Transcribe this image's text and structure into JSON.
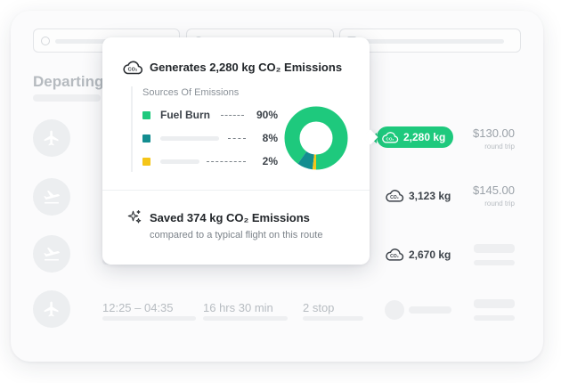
{
  "page": {
    "section_title": "Departing"
  },
  "search": {
    "fields": [
      {
        "icon": "search-icon"
      },
      {
        "icon": "location-icon"
      },
      {
        "icon": "calendar-icon"
      }
    ]
  },
  "flights": [
    {
      "emissions": "2,280 kg",
      "price": "$130.00",
      "price_note": "round trip",
      "selected": true
    },
    {
      "emissions": "3,123 kg",
      "price": "$145.00",
      "price_note": "round trip",
      "selected": false
    },
    {
      "emissions": "2,670 kg",
      "price": "",
      "price_note": "",
      "selected": false
    },
    {
      "time": "12:25 – 04:35",
      "duration": "16 hrs 30 min",
      "stops": "2 stop",
      "emissions": "",
      "price": ""
    }
  ],
  "popover": {
    "title": "Generates 2,280 kg CO₂ Emissions",
    "sources_title": "Sources Of Emissions",
    "sources": [
      {
        "label": "Fuel Burn",
        "percent": "90%",
        "value": 90,
        "color": "#1ec97d"
      },
      {
        "label": "",
        "percent": "8%",
        "value": 8,
        "color": "#138d90"
      },
      {
        "label": "",
        "percent": "2%",
        "value": 2,
        "color": "#f5c518"
      }
    ],
    "saved_title": "Saved 374 kg CO₂ Emissions",
    "saved_subtitle": "compared to a typical flight on this route"
  },
  "colors": {
    "accent": "#1ec97d",
    "teal": "#138d90",
    "yellow": "#f5c518"
  },
  "icons": {
    "co2": "co2-cloud-icon",
    "plane": "airplane-icon",
    "sparkle": "sparkle-icon"
  }
}
